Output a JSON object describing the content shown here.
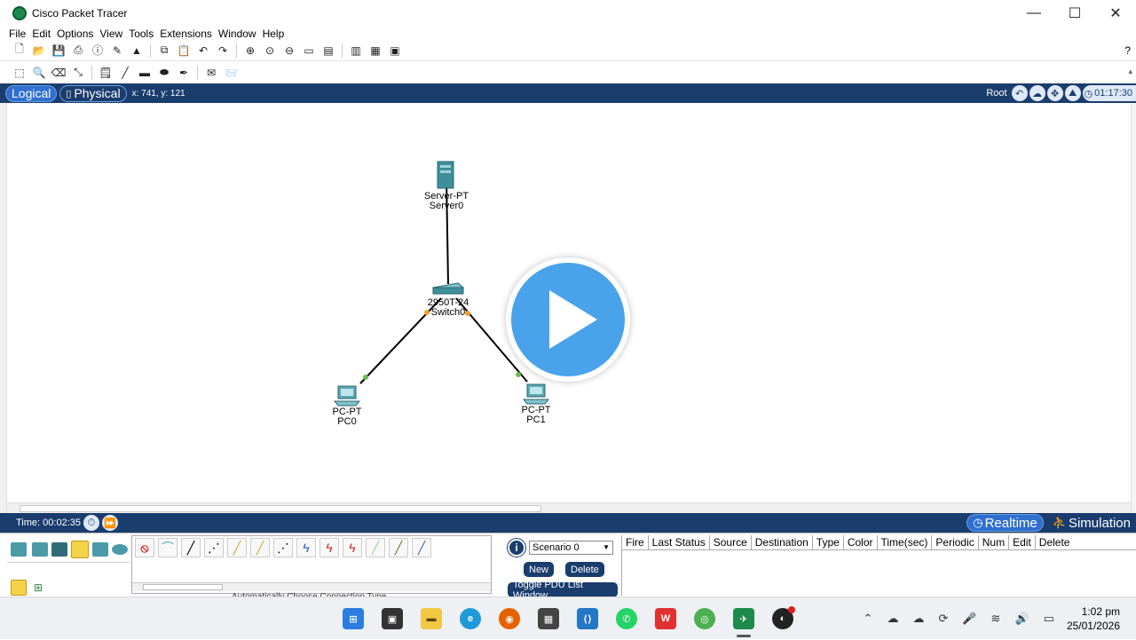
{
  "window": {
    "title": "Cisco Packet Tracer",
    "minimize": "—",
    "maximize": "☐",
    "close": "✕"
  },
  "menu": [
    "File",
    "Edit",
    "Options",
    "View",
    "Tools",
    "Extensions",
    "Window",
    "Help"
  ],
  "toolbar": {
    "help": "?"
  },
  "workspace": {
    "logical_tab": "Logical",
    "physical_tab": "Physical",
    "coords": "x: 741, y: 121",
    "root_label": "Root",
    "clock": "01:17:30"
  },
  "devices": {
    "server": {
      "model": "Server-PT",
      "name": "Server0"
    },
    "switch": {
      "model": "2950T-24",
      "name": "Switch0"
    },
    "pc0": {
      "model": "PC-PT",
      "name": "PC0"
    },
    "pc1": {
      "model": "PC-PT",
      "name": "PC1"
    }
  },
  "timebar": {
    "time": "Time: 00:02:35",
    "realtime": "Realtime",
    "simulation": "Simulation"
  },
  "connections": {
    "caption": "Automatically Choose Connection Type"
  },
  "scenario": {
    "info": "i",
    "selected": "Scenario 0",
    "new": "New",
    "delete": "Delete",
    "toggle": "Toggle PDU List Window"
  },
  "pdu_columns": [
    "Fire",
    "Last Status",
    "Source",
    "Destination",
    "Type",
    "Color",
    "Time(sec)",
    "Periodic",
    "Num",
    "Edit",
    "Delete"
  ],
  "taskbar": {
    "time": "1:02 pm",
    "date": "25/01/2026"
  },
  "colors": {
    "navbar": "#1a3d6e",
    "active_tab": "#2f6fd0",
    "play_button": "#4aa3ea",
    "link_up": "#6abf4b",
    "link_pending": "#f0a030"
  }
}
